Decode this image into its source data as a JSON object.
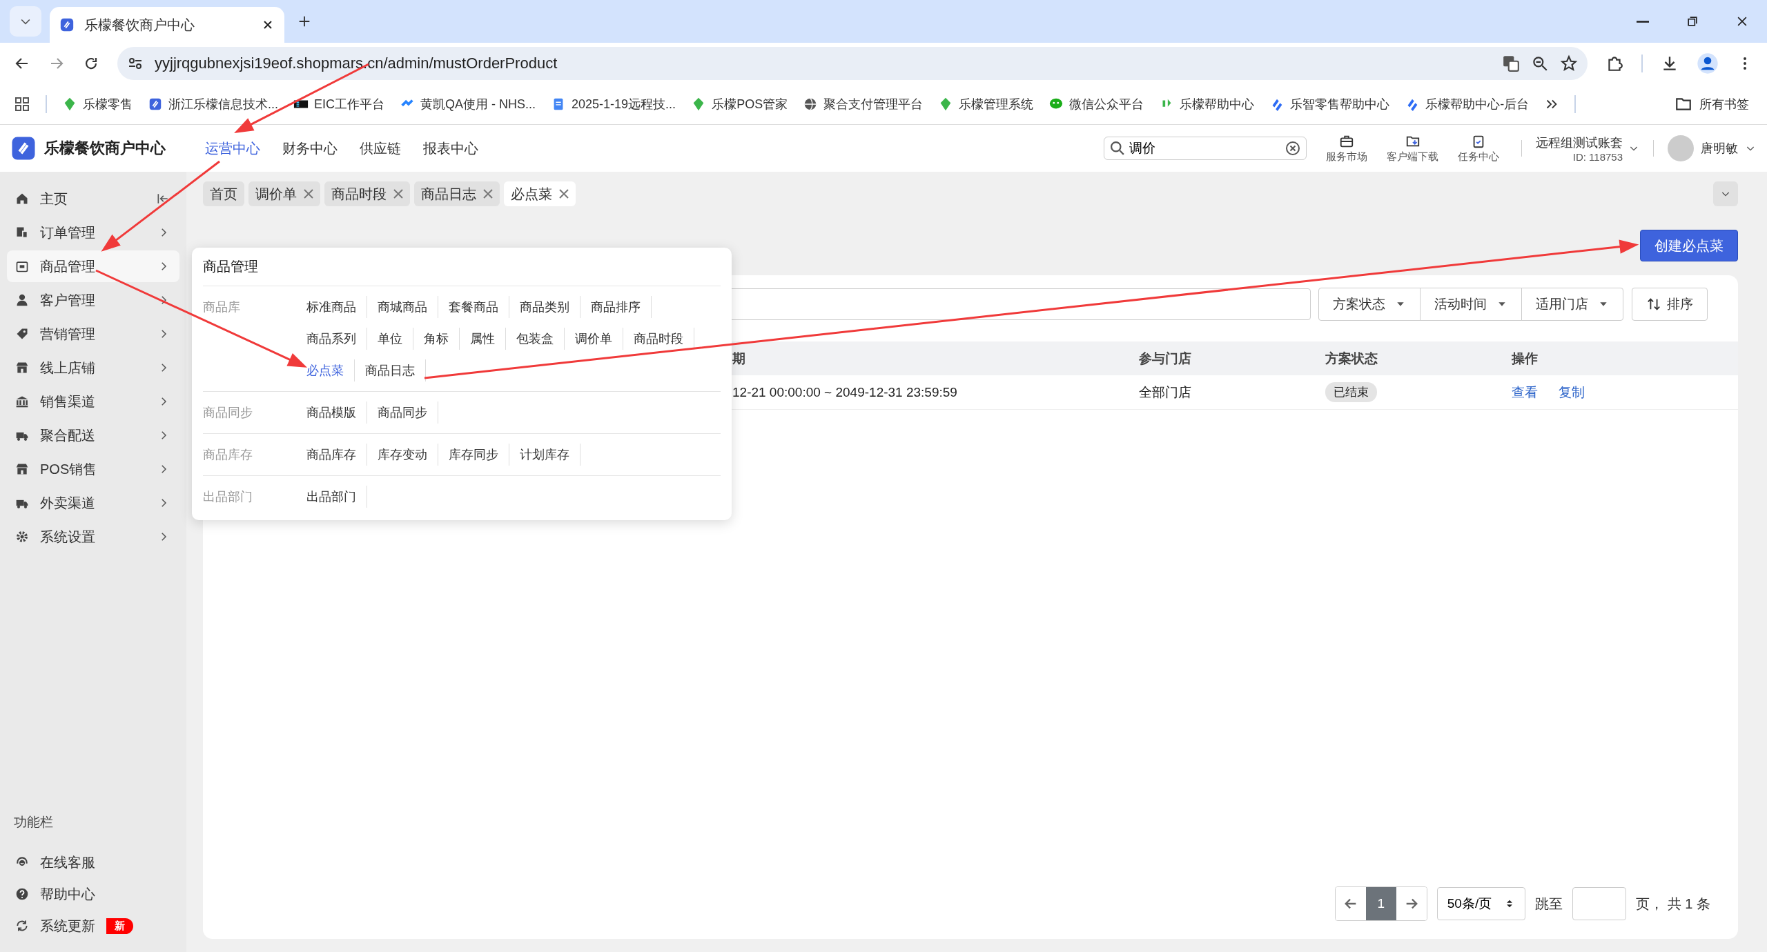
{
  "browser": {
    "tab_title": "乐檬餐饮商户中心",
    "url": "yyjjrqgubnexjsi19eof.shopmars.cn/admin/mustOrderProduct",
    "bookmarks": [
      "乐檬零售",
      "浙江乐檬信息技术...",
      "EIC工作平台",
      "黄凯QA使用 - NHS...",
      "2025-1-19远程技...",
      "乐檬POS管家",
      "聚合支付管理平台",
      "乐檬管理系统",
      "微信公众平台",
      "乐檬帮助中心",
      "乐智零售帮助中心",
      "乐檬帮助中心-后台"
    ],
    "all_bookmarks": "所有书签"
  },
  "header": {
    "brand": "乐檬餐饮商户中心",
    "nav": [
      {
        "label": "运营中心",
        "selected": true
      },
      {
        "label": "财务中心",
        "selected": false
      },
      {
        "label": "供应链",
        "selected": false
      },
      {
        "label": "报表中心",
        "selected": false
      }
    ],
    "search": {
      "value": "调价"
    },
    "tools": [
      "服务市场",
      "客户端下载",
      "任务中心"
    ],
    "account": {
      "name": "远程组测试账套",
      "id": "ID: 118753"
    },
    "user": "唐明敏"
  },
  "sidebar": {
    "items": [
      {
        "label": "主页",
        "selected": false
      },
      {
        "label": "订单管理",
        "selected": false
      },
      {
        "label": "商品管理",
        "selected": true
      },
      {
        "label": "客户管理",
        "selected": false
      },
      {
        "label": "营销管理",
        "selected": false
      },
      {
        "label": "线上店铺",
        "selected": false
      },
      {
        "label": "销售渠道",
        "selected": false
      },
      {
        "label": "聚合配送",
        "selected": false
      },
      {
        "label": "POS销售",
        "selected": false
      },
      {
        "label": "外卖渠道",
        "selected": false
      },
      {
        "label": "系统设置",
        "selected": false
      }
    ],
    "tools_title": "功能栏",
    "tools": [
      {
        "label": "在线客服"
      },
      {
        "label": "帮助中心"
      },
      {
        "label": "系统更新",
        "badge": "新"
      }
    ]
  },
  "page_tabs": [
    {
      "label": "首页",
      "selected": false,
      "closable": false
    },
    {
      "label": "调价单",
      "selected": false,
      "closable": true
    },
    {
      "label": "商品时段",
      "selected": false,
      "closable": true
    },
    {
      "label": "商品日志",
      "selected": false,
      "closable": true
    },
    {
      "label": "必点菜",
      "selected": true,
      "closable": true
    }
  ],
  "page": {
    "create_button": "创建必点菜",
    "filters": [
      "方案状态",
      "活动时间",
      "适用门店"
    ],
    "sort_button": "排序",
    "table": {
      "columns": [
        "期",
        "参与门店",
        "方案状态",
        "操作"
      ],
      "rows": [
        {
          "period": "12-21 00:00:00 ~ 2049-12-31 23:59:59",
          "stores": "全部门店",
          "status": "已结束",
          "actions": [
            "查看",
            "复制"
          ]
        }
      ]
    },
    "pagination": {
      "pages": [
        {
          "label": "1",
          "selected": true
        }
      ],
      "page_size": "50条/页",
      "jump_label": "跳至",
      "total": "页， 共 1 条"
    }
  },
  "menu": {
    "title": "商品管理",
    "sections": [
      {
        "label": "商品库",
        "links": [
          {
            "text": "标准商品",
            "selected": false
          },
          {
            "text": "商城商品",
            "selected": false
          },
          {
            "text": "套餐商品",
            "selected": false
          },
          {
            "text": "商品类别",
            "selected": false
          },
          {
            "text": "商品排序",
            "selected": false
          },
          {
            "text": "商品系列",
            "selected": false
          },
          {
            "text": "单位",
            "selected": false
          },
          {
            "text": "角标",
            "selected": false
          },
          {
            "text": "属性",
            "selected": false
          },
          {
            "text": "包装盒",
            "selected": false
          },
          {
            "text": "调价单",
            "selected": false
          },
          {
            "text": "商品时段",
            "selected": false
          },
          {
            "text": "必点菜",
            "selected": true
          },
          {
            "text": "商品日志",
            "selected": false
          }
        ]
      },
      {
        "label": "商品同步",
        "links": [
          {
            "text": "商品模版",
            "selected": false
          },
          {
            "text": "商品同步",
            "selected": false
          }
        ]
      },
      {
        "label": "商品库存",
        "links": [
          {
            "text": "商品库存",
            "selected": false
          },
          {
            "text": "库存变动",
            "selected": false
          },
          {
            "text": "库存同步",
            "selected": false
          },
          {
            "text": "计划库存",
            "selected": false
          }
        ]
      },
      {
        "label": "出品部门",
        "links": [
          {
            "text": "出品部门",
            "selected": false
          }
        ]
      }
    ]
  }
}
